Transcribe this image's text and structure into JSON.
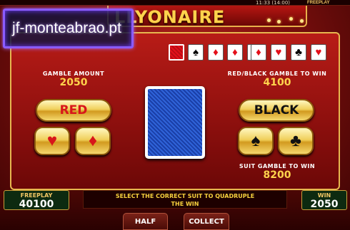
{
  "top_bar": {
    "clock": "11:33 (14:00)",
    "freeplay_tag": "FREEPLAY"
  },
  "title": "LLYONAIRE",
  "watermark": "jf-monteabrao.pt",
  "history": [
    {
      "suit": "back",
      "symbol": ""
    },
    {
      "suit": "spade",
      "symbol": "♠",
      "color": "black"
    },
    {
      "suit": "diamond",
      "symbol": "♦",
      "color": "red"
    },
    {
      "suit": "diamond",
      "symbol": "♦",
      "color": "red"
    },
    {
      "suit": "diamond",
      "symbol": "♦",
      "color": "red"
    },
    {
      "suit": "diamond",
      "symbol": "♦",
      "color": "red"
    },
    {
      "suit": "heart",
      "symbol": "♥",
      "color": "red"
    },
    {
      "suit": "club",
      "symbol": "♣",
      "color": "black"
    },
    {
      "suit": "heart",
      "symbol": "♥",
      "color": "red"
    }
  ],
  "gamble": {
    "amount_label": "GAMBLE AMOUNT",
    "amount": "2050",
    "rb_label": "RED/BLACK GAMBLE TO WIN",
    "rb_value": "4100",
    "suit_label": "SUIT GAMBLE TO WIN",
    "suit_value": "8200"
  },
  "buttons": {
    "red": "RED",
    "black": "BLACK",
    "heart": "♥",
    "diamond": "♦",
    "spade": "♠",
    "club": "♣",
    "half": "HALF",
    "collect": "COLLECT"
  },
  "footer": {
    "freeplay_label": "FREEPLAY",
    "freeplay_value": "40100",
    "message_line1": "SELECT THE CORRECT SUIT TO QUADRUPLE",
    "message_line2": "THE WIN",
    "win_label": "WIN",
    "win_value": "2050"
  },
  "colors": {
    "gold": "#ffd34c",
    "red_suit": "#e4101a",
    "panel": "#b81c17"
  }
}
